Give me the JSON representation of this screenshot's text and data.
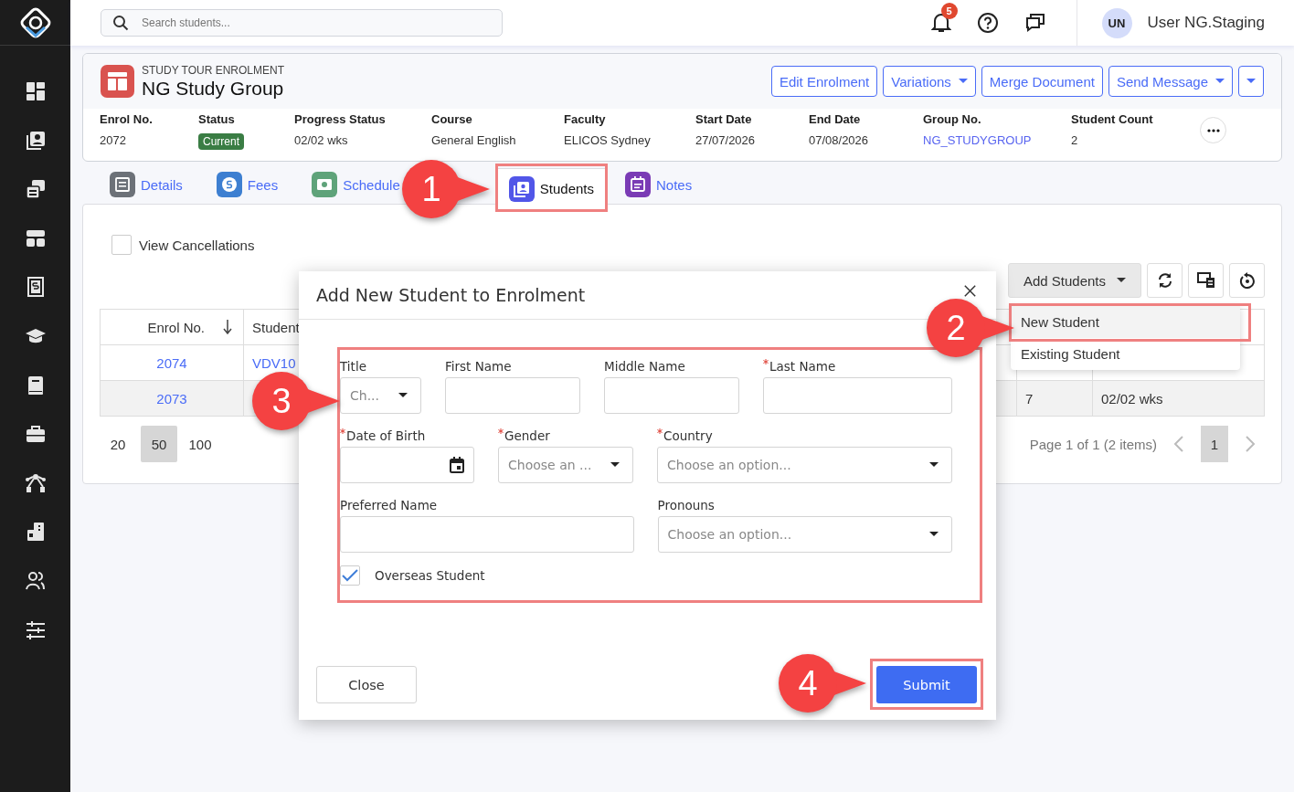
{
  "search": {
    "placeholder": "Search students..."
  },
  "notifications": {
    "count": "5"
  },
  "user": {
    "initials": "UN",
    "name": "User NG.Staging"
  },
  "enrolment": {
    "type_label": "STUDY TOUR ENROLMENT",
    "title": "NG Study Group",
    "actions": [
      {
        "label": "Edit Enrolment",
        "kind": "button"
      },
      {
        "label": "Variations",
        "kind": "dropdown"
      },
      {
        "label": "Merge Document",
        "kind": "button"
      },
      {
        "label": "Send Message",
        "kind": "dropdown"
      },
      {
        "kind": "caret"
      }
    ],
    "fields": [
      {
        "label": "Enrol No.",
        "value": "2072",
        "kind": "text"
      },
      {
        "label": "Status",
        "value": "Current",
        "kind": "badge"
      },
      {
        "label": "Progress Status",
        "value": "02/02 wks",
        "kind": "text"
      },
      {
        "label": "Course",
        "value": "General English",
        "kind": "text"
      },
      {
        "label": "Faculty",
        "value": "ELICOS Sydney",
        "kind": "text"
      },
      {
        "label": "Start Date",
        "value": "27/07/2026",
        "kind": "text"
      },
      {
        "label": "End Date",
        "value": "07/08/2026",
        "kind": "text"
      },
      {
        "label": "Group No.",
        "value": "NG_STUDYGROUP",
        "kind": "link"
      },
      {
        "label": "Student Count",
        "value": "2",
        "kind": "text"
      }
    ]
  },
  "tabs": [
    {
      "label": "Details",
      "selected": false,
      "highlighted": false,
      "color": "#6c7178"
    },
    {
      "label": "Fees",
      "selected": false,
      "highlighted": false,
      "color": "#3d7fd1"
    },
    {
      "label": "Schedule",
      "selected": false,
      "highlighted": false,
      "color": "#5fa37a"
    },
    {
      "label": "Students",
      "selected": true,
      "highlighted": true,
      "color": "#5156e8"
    },
    {
      "label": "Notes",
      "selected": false,
      "highlighted": false,
      "color": "#7a3bb5"
    }
  ],
  "view_cancellations": {
    "label": "View Cancellations",
    "checked": false
  },
  "add_students": {
    "label": "Add Students",
    "menu": [
      {
        "label": "New Student",
        "highlighted": true
      },
      {
        "label": "Existing Student",
        "highlighted": false
      }
    ]
  },
  "table": {
    "columns": [
      {
        "label": "Enrol No.",
        "sorted": true
      },
      {
        "label": "Student",
        "sorted": false
      }
    ],
    "rows": [
      {
        "enrol_no": "2074",
        "student": "VDV10"
      },
      {
        "enrol_no": "2073",
        "column_3": "7",
        "column_4": "02/02 wks"
      }
    ]
  },
  "pagination": {
    "page_sizes": [
      {
        "label": "20",
        "selected": false
      },
      {
        "label": "50",
        "selected": true
      },
      {
        "label": "100",
        "selected": false
      }
    ],
    "summary": "Page 1 of 1 (2 items)",
    "pages": [
      {
        "label": "1",
        "selected": true
      }
    ]
  },
  "modal": {
    "title": "Add New Student to Enrolment",
    "highlighted": true,
    "rows": [
      [
        {
          "label": "Title",
          "required": false,
          "kind": "select",
          "placeholder": "Ch..."
        },
        {
          "label": "First Name",
          "required": false,
          "kind": "text"
        },
        {
          "label": "Middle Name",
          "required": false,
          "kind": "text"
        },
        {
          "label": "Last Name",
          "required": true,
          "kind": "text"
        }
      ],
      [
        {
          "label": "Date of Birth",
          "required": true,
          "kind": "date"
        },
        {
          "label": "Gender",
          "required": true,
          "kind": "select",
          "placeholder": "Choose an ..."
        },
        {
          "label": "Country",
          "required": true,
          "kind": "select",
          "placeholder": "Choose an option..."
        }
      ],
      [
        {
          "label": "Preferred Name",
          "required": false,
          "kind": "text"
        },
        {
          "label": "Pronouns",
          "required": false,
          "kind": "select",
          "placeholder": "Choose an option..."
        }
      ]
    ],
    "overseas": {
      "label": "Overseas Student",
      "checked": true
    },
    "close_button": {
      "label": "Close"
    },
    "submit_button": {
      "label": "Submit",
      "highlighted": true
    }
  },
  "annotations": [
    {
      "number": "1"
    },
    {
      "number": "2"
    },
    {
      "number": "3"
    },
    {
      "number": "4"
    }
  ]
}
